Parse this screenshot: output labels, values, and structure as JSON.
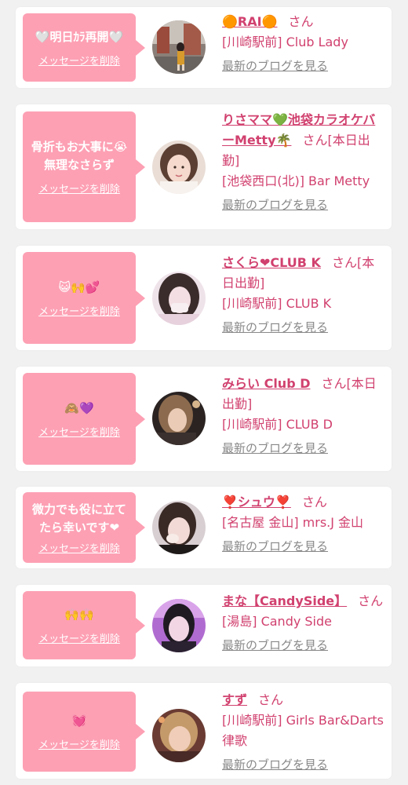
{
  "colors": {
    "page_bg": "#f1f1f1",
    "card_bg": "#ffffff",
    "bubble_bg": "#fda0b4",
    "accent_text": "#d1416f",
    "link_gray": "#888888"
  },
  "cards": [
    {
      "message": "🤍明日ｶﾗ再開🤍",
      "delete_label": "メッセージを削除",
      "name": "🟠RAI🟠",
      "san": "さん",
      "status": "",
      "shop": "[川崎駅前] Club Lady",
      "blog_link": "最新のブログを見る"
    },
    {
      "message": "骨折もお大事に😭\n無理なさらず",
      "delete_label": "メッセージを削除",
      "name": "りさママ💚池袋カラオケバーMetty🌴",
      "san": "さん",
      "status": "[本日出勤]",
      "shop": "[池袋西口(北)] Bar Metty",
      "blog_link": "最新のブログを見る"
    },
    {
      "message": "😺🙌💕",
      "delete_label": "メッセージを削除",
      "name": "さくら❤CLUB K",
      "san": "さん",
      "status": "[本日出勤]",
      "shop": "[川崎駅前] CLUB K",
      "blog_link": "最新のブログを見る"
    },
    {
      "message": "🙈💜",
      "delete_label": "メッセージを削除",
      "name": "みらい Club D",
      "san": "さん",
      "status": "[本日出勤]",
      "shop": "[川崎駅前] CLUB D",
      "blog_link": "最新のブログを見る"
    },
    {
      "message": "微力でも役に立てたら幸いです❤",
      "delete_label": "メッセージを削除",
      "name": "❣️シュウ❣️",
      "san": "さん",
      "status": "",
      "shop": "[名古屋 金山] mrs.J 金山",
      "blog_link": "最新のブログを見る"
    },
    {
      "message": "🙌🙌",
      "delete_label": "メッセージを削除",
      "name": "まな【CandySide】",
      "san": "さん",
      "status": "",
      "shop": "[湯島] Candy Side",
      "blog_link": "最新のブログを見る"
    },
    {
      "message": "💓",
      "delete_label": "メッセージを削除",
      "name": "すず",
      "san": "さん",
      "status": "",
      "shop": "[川崎駅前] Girls Bar&Darts 律歌",
      "blog_link": "最新のブログを見る"
    }
  ]
}
